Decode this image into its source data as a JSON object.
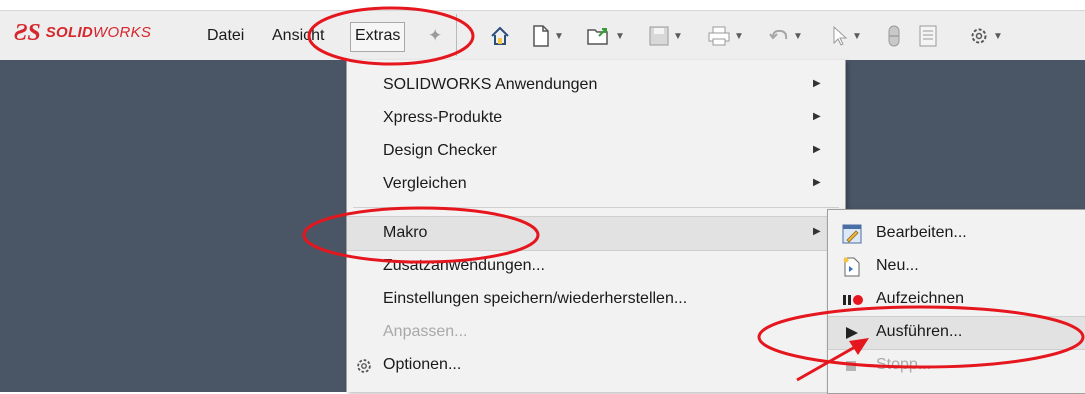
{
  "app": {
    "brand_prefix": "SOLID",
    "brand_suffix": "WORKS",
    "brand_symbol": "ƧS"
  },
  "menubar": {
    "items": [
      "Datei",
      "Ansicht",
      "Extras"
    ],
    "active": "Extras"
  },
  "toolbar": {
    "icons": [
      "pin-icon",
      "home-icon",
      "new-document-icon",
      "open-folder-icon",
      "save-icon",
      "print-icon",
      "undo-icon",
      "select-cursor-icon",
      "rebuild-icon",
      "file-properties-icon",
      "options-gear-icon"
    ]
  },
  "extras_menu": {
    "items": [
      {
        "label": "SOLIDWORKS Anwendungen",
        "submenu": true
      },
      {
        "label": "Xpress-Produkte",
        "submenu": true
      },
      {
        "label": "Design Checker",
        "submenu": true
      },
      {
        "label": "Vergleichen",
        "submenu": true
      },
      {
        "label": "Makro",
        "submenu": true,
        "highlighted": true
      },
      {
        "label": "Zusatzanwendungen...",
        "submenu": false
      },
      {
        "label": "Einstellungen speichern/wiederherstellen...",
        "submenu": false
      },
      {
        "label": "Anpassen...",
        "submenu": false,
        "disabled": true
      },
      {
        "label": "Optionen...",
        "submenu": false,
        "icon": "gear-icon"
      }
    ]
  },
  "makro_submenu": {
    "items": [
      {
        "label": "Bearbeiten...",
        "icon": "macro-edit-icon"
      },
      {
        "label": "Neu...",
        "icon": "macro-new-icon"
      },
      {
        "label": "Aufzeichnen",
        "icon": "record-icon"
      },
      {
        "label": "Ausführen...",
        "icon": "run-play-icon",
        "highlighted": true
      },
      {
        "label": "Stopp...",
        "icon": "stop-icon",
        "disabled": true
      }
    ]
  },
  "colors": {
    "workspace": "#4a5565",
    "annotation": "#e5161d",
    "brand": "#d6272c"
  }
}
